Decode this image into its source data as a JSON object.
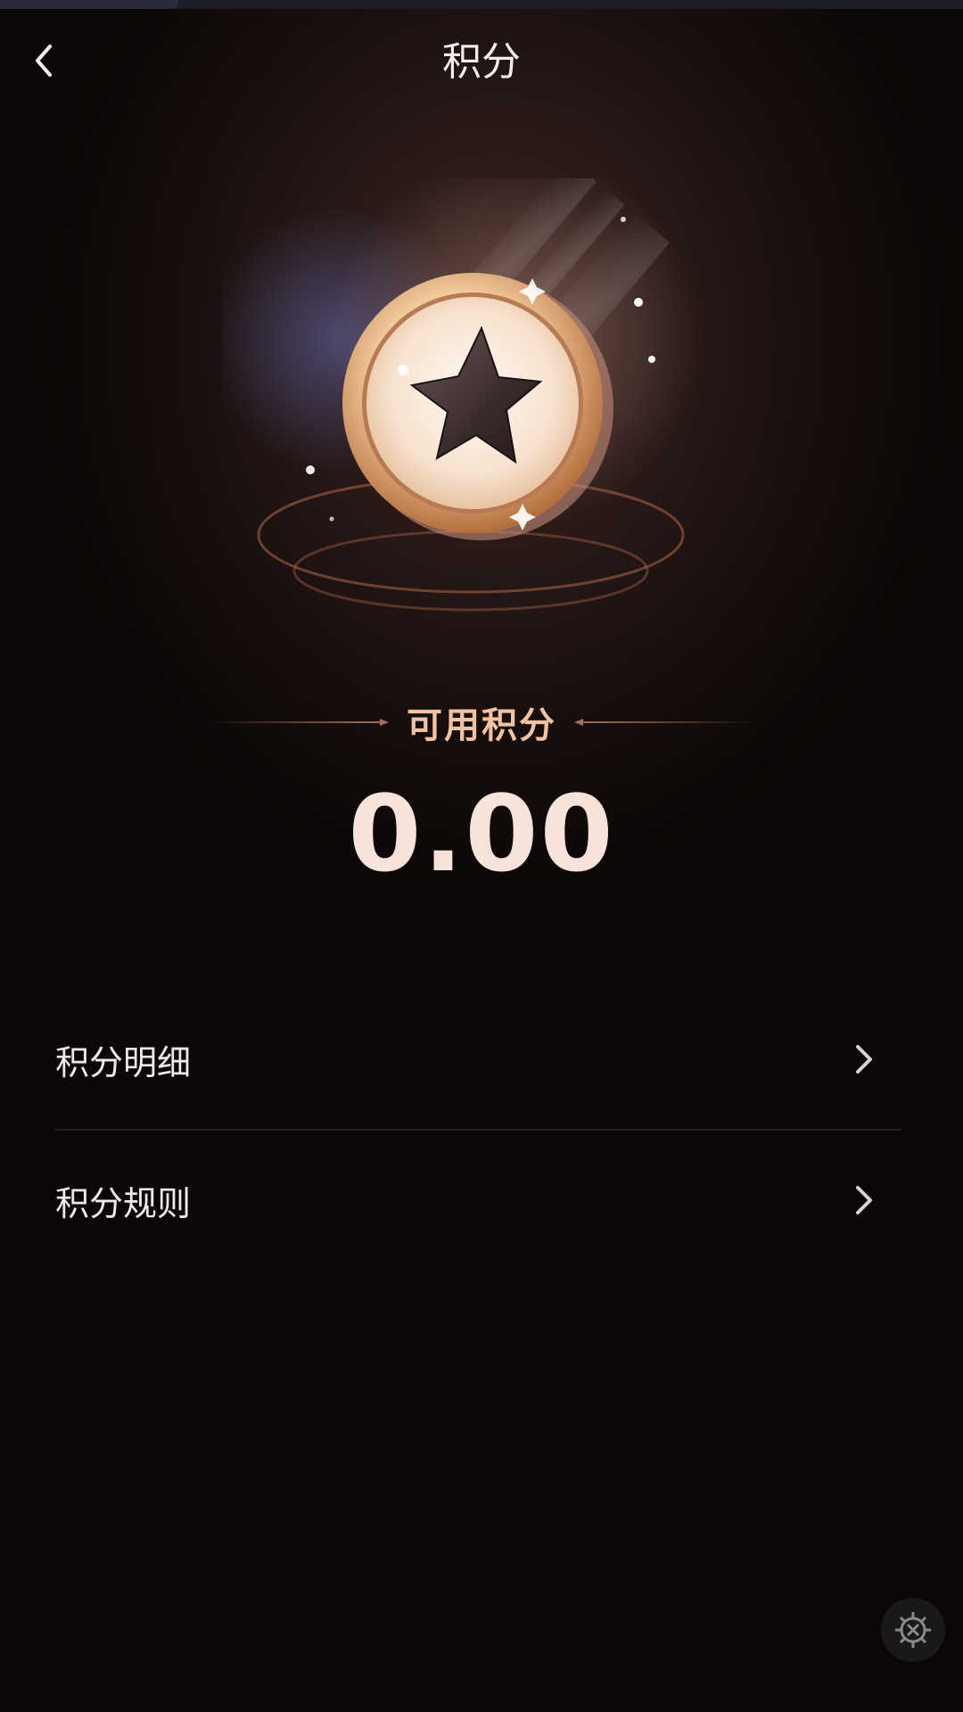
{
  "header": {
    "title": "积分"
  },
  "hero": {
    "label": "可用积分",
    "value": "0.00"
  },
  "menu": {
    "items": [
      {
        "label": "积分明细"
      },
      {
        "label": "积分规则"
      }
    ]
  },
  "colors": {
    "accent": "#f3c2a0",
    "value_text": "#f8e3da",
    "background": "#0b0706"
  },
  "icons": {
    "back": "chevron-left-icon",
    "coin": "star-coin-icon",
    "menu_chevron": "chevron-right-icon",
    "fab": "gear-icon"
  }
}
